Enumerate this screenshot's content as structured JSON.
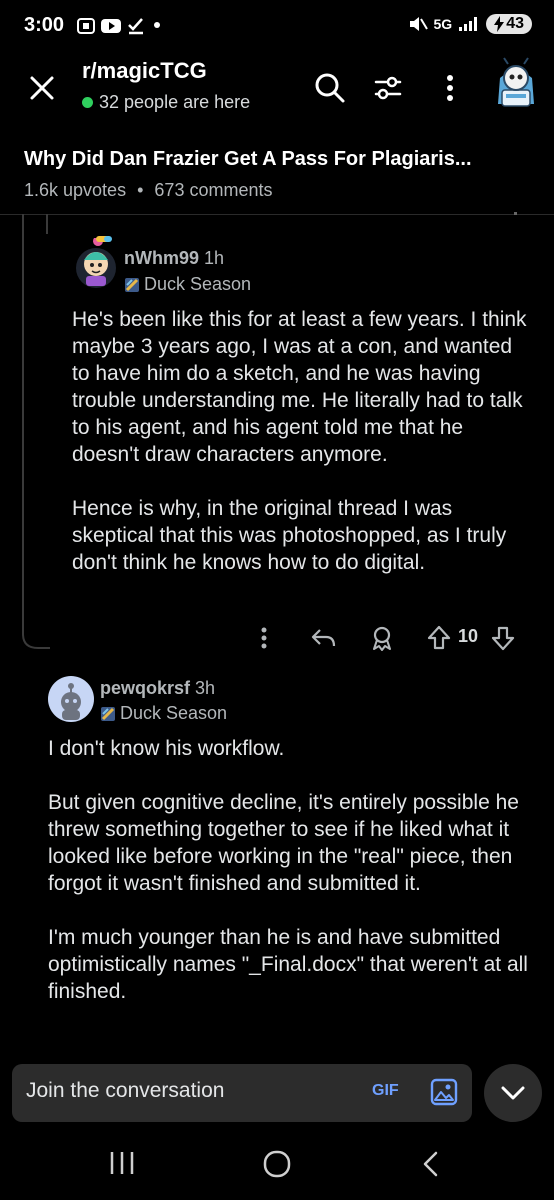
{
  "status_bar": {
    "time": "3:00",
    "network": "5G",
    "battery": "43"
  },
  "header": {
    "subreddit": "r/magicTCG",
    "online": "32 people are here"
  },
  "post": {
    "title": "Why Did Dan Frazier Get A Pass For Plagiaris...",
    "upvotes": "1.6k upvotes",
    "separator": "•",
    "comments": "673 comments"
  },
  "comments": [
    {
      "username": "nWhm99",
      "time": "1h",
      "flair": "Duck Season",
      "body": "He's been like this for at least a few years. I think maybe 3 years ago, I was at a con, and wanted to have him do a sketch, and he was having trouble understanding me. He literally had to talk to his agent, and his agent told me that he doesn't draw characters anymore.\n\nHence is why, in the original thread I was skeptical that this was photoshopped, as I truly don't think he knows how to do digital.",
      "votes": "10"
    },
    {
      "username": "pewqokrsf",
      "time": "3h",
      "flair": "Duck Season",
      "body": "I don't know his workflow.\n\nBut given cognitive decline, it's entirely possible he threw something together to see if he liked what it looked like before working in the \"real\" piece, then forgot it wasn't finished and submitted it.\n\nI'm much younger than he is and have submitted optimistically names \"_Final.docx\" that weren't at all finished."
    }
  ],
  "composer": {
    "placeholder": "Join the conversation",
    "gif_label": "GIF"
  },
  "colors": {
    "background": "#000000",
    "online_dot": "#2fcf5e",
    "accent_blue": "#6fa0ff"
  }
}
